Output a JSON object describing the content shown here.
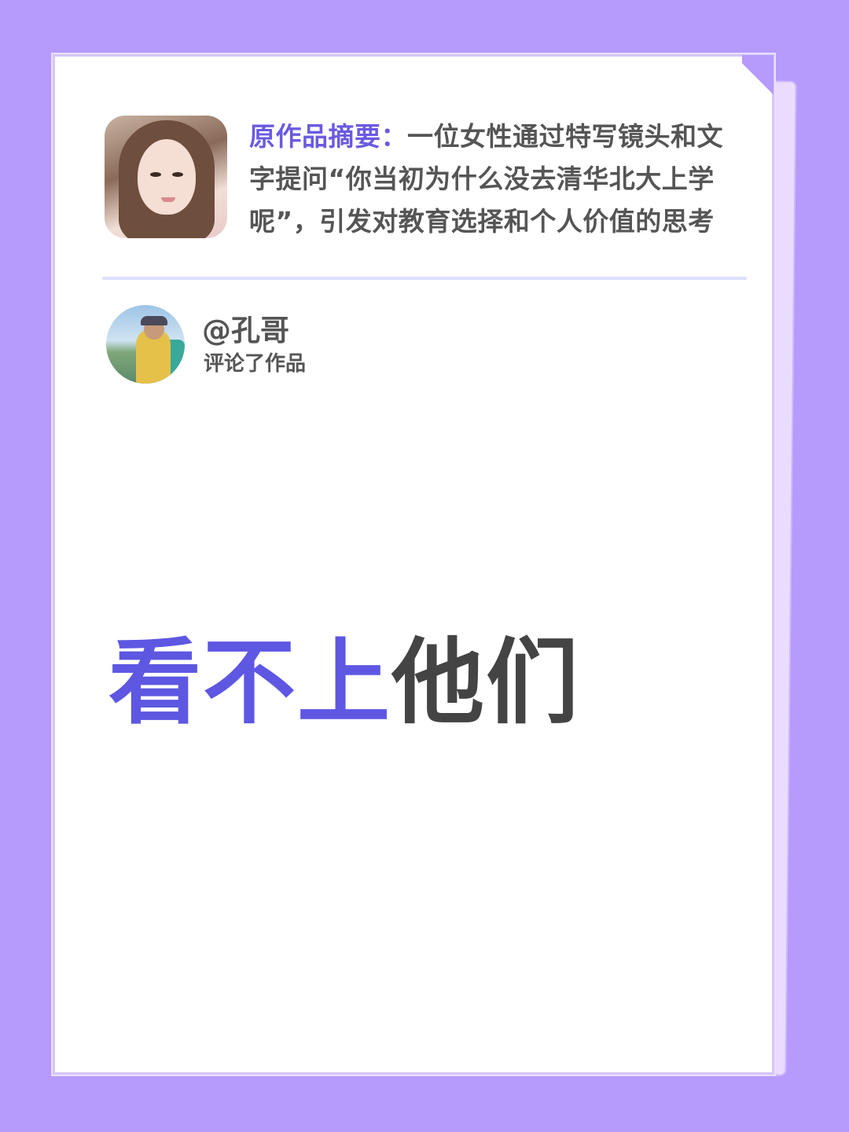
{
  "summary": {
    "label": "原作品摘要：",
    "text": "一位女性通过特写镜头和文字提问“你当初为什么没去清华北大上学呢”，引发对教育选择和个人价值的思考"
  },
  "comment_header": {
    "username": "@孔哥",
    "action": "评论了作品"
  },
  "comment": {
    "highlight": "看不上",
    "rest": "他们"
  },
  "colors": {
    "background": "#b69afc",
    "accent": "#5d57e2",
    "label": "#6a5ae0",
    "text": "#555555"
  }
}
